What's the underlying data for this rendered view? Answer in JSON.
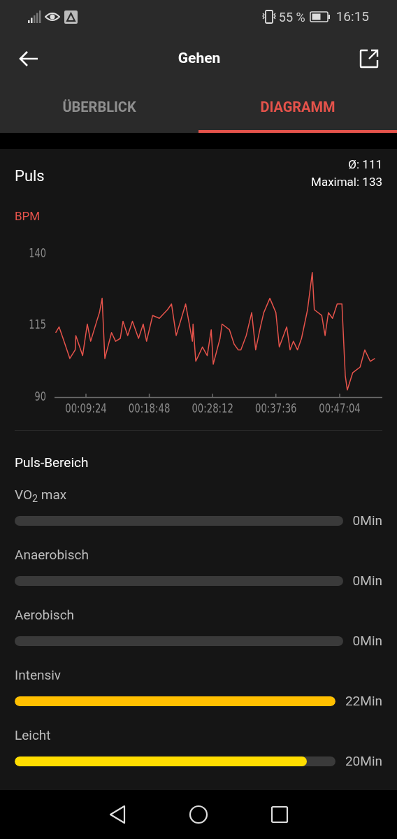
{
  "status_bar": {
    "battery": "55 %",
    "time": "16:15"
  },
  "header": {
    "title": "Gehen"
  },
  "tabs": [
    {
      "label": "ÜBERBLICK",
      "selected": false
    },
    {
      "label": "DIAGRAMM",
      "selected": true
    }
  ],
  "pulse": {
    "title": "Puls",
    "average": "Ø: 111",
    "maximum": "Maximal: 133",
    "unit": "BPM",
    "chart_data": {
      "type": "line",
      "xlim": [
        4.73,
        53.4
      ],
      "ylim": [
        90,
        140
      ],
      "yticks": [
        90,
        115,
        140
      ],
      "xticks": [
        {
          "value": 9.4,
          "label": "00:09:24"
        },
        {
          "value": 18.8,
          "label": "00:18:48"
        },
        {
          "value": 28.2,
          "label": "00:28:12"
        },
        {
          "value": 37.6,
          "label": "00:37:36"
        },
        {
          "value": 47.07,
          "label": "00:47:04"
        }
      ],
      "x": [
        4.9,
        5.4,
        6.0,
        7.0,
        7.8,
        7.9,
        8.9,
        9.6,
        10.1,
        11.0,
        11.4,
        11.8,
        12.2,
        13.2,
        13.8,
        14.5,
        14.9,
        15.6,
        16.3,
        17.2,
        17.9,
        18.4,
        19.3,
        20.3,
        21.5,
        22.1,
        22.8,
        24.2,
        25.2,
        25.3,
        25.7,
        26.7,
        27.4,
        28.0,
        28.3,
        29.3,
        29.6,
        30.7,
        31.4,
        32.0,
        32.4,
        33.2,
        34.0,
        34.6,
        35.3,
        35.8,
        36.7,
        37.6,
        38.1,
        39.2,
        39.7,
        40.2,
        40.8,
        41.4,
        42.3,
        43.0,
        43.3,
        44.4,
        44.9,
        45.4,
        46.0,
        46.7,
        47.4,
        47.9,
        48.2,
        49.0,
        50.1,
        50.8,
        51.6,
        52.3
      ],
      "series": [
        {
          "color": "#e5534b",
          "values": [
            112,
            114,
            110,
            103,
            106,
            111,
            104,
            115,
            109,
            116,
            119,
            124,
            103,
            112,
            109,
            110,
            116,
            111,
            116,
            110,
            115,
            109,
            118,
            117,
            120,
            122,
            111,
            122,
            109,
            115,
            102,
            107,
            104,
            113,
            101,
            110,
            115,
            113,
            108,
            106,
            106,
            111,
            119,
            106,
            114,
            119,
            124,
            119,
            107,
            114,
            106,
            109,
            106,
            110,
            120,
            133,
            120,
            118,
            111,
            119,
            117,
            122,
            122,
            97,
            92,
            98,
            100,
            106,
            102,
            103
          ]
        }
      ]
    }
  },
  "zones": {
    "title": "Puls-Bereich",
    "items": [
      {
        "label": "VO$_{2}$ max",
        "time": "0Min"
      },
      {
        "label": "Anaerobisch",
        "time": "0Min"
      },
      {
        "label": "Aerobisch",
        "time": "0Min"
      },
      {
        "label": "Intensiv",
        "level": 1,
        "time": "22Min",
        "color": "#ffc000"
      },
      {
        "label": "Leicht",
        "level": 0.91,
        "time": "20Min",
        "color": "#ffdd00"
      }
    ]
  }
}
